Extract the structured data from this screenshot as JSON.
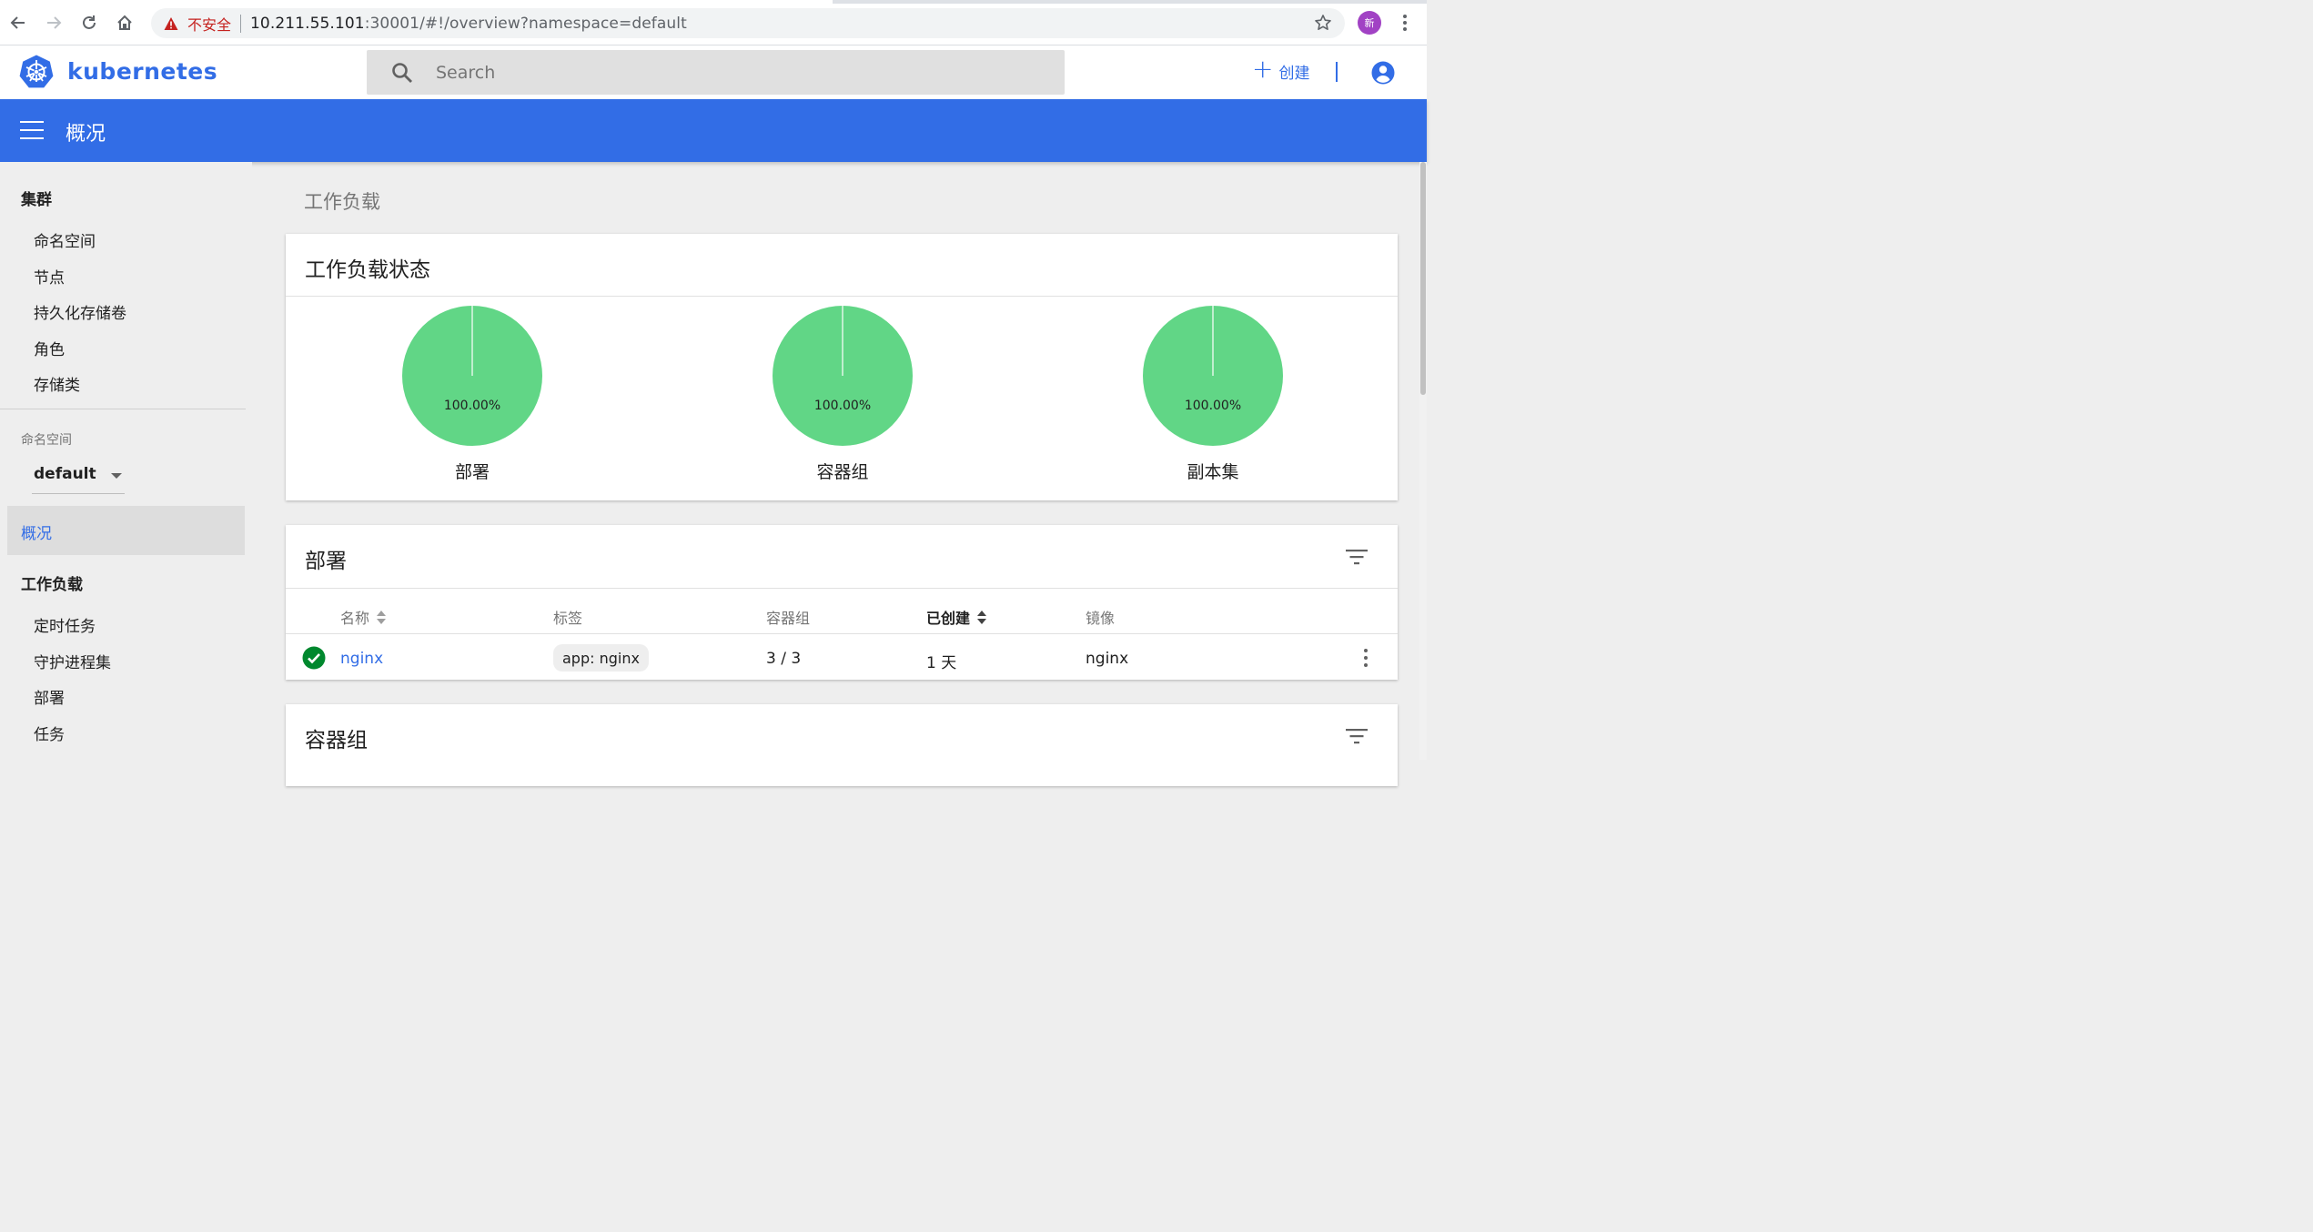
{
  "browser": {
    "insecure_label": "不安全",
    "url_host": "10.211.55.101",
    "url_rest": ":30001/#!/overview?namespace=default",
    "profile_initial": "新"
  },
  "header": {
    "brand": "kubernetes",
    "search_placeholder": "Search",
    "create_label": "创建",
    "brand_color": "#326de6"
  },
  "titlebar": {
    "title": "概况"
  },
  "sidebar": {
    "cluster_heading": "集群",
    "cluster_items": [
      "命名空间",
      "节点",
      "持久化存储卷",
      "角色",
      "存储类"
    ],
    "namespace_label": "命名空间",
    "namespace_value": "default",
    "overview_label": "概况",
    "workloads_heading": "工作负载",
    "workload_items": [
      "定时任务",
      "守护进程集",
      "部署",
      "任务"
    ]
  },
  "main": {
    "section_label": "工作负载",
    "status_card": {
      "title": "工作负载状态",
      "pies": [
        {
          "name": "部署",
          "percent_label": "100.00%",
          "fraction": 1.0,
          "color": "#61d686"
        },
        {
          "name": "容器组",
          "percent_label": "100.00%",
          "fraction": 1.0,
          "color": "#61d686"
        },
        {
          "name": "副本集",
          "percent_label": "100.00%",
          "fraction": 1.0,
          "color": "#61d686"
        }
      ]
    },
    "deployments_card": {
      "title": "部署",
      "columns": [
        "名称",
        "标签",
        "容器组",
        "已创建",
        "镜像"
      ],
      "rows": [
        {
          "name": "nginx",
          "label": "app: nginx",
          "pods": "3 / 3",
          "created": "1 天",
          "image": "nginx",
          "status": "ok"
        }
      ]
    },
    "pods_card": {
      "title": "容器组"
    }
  }
}
